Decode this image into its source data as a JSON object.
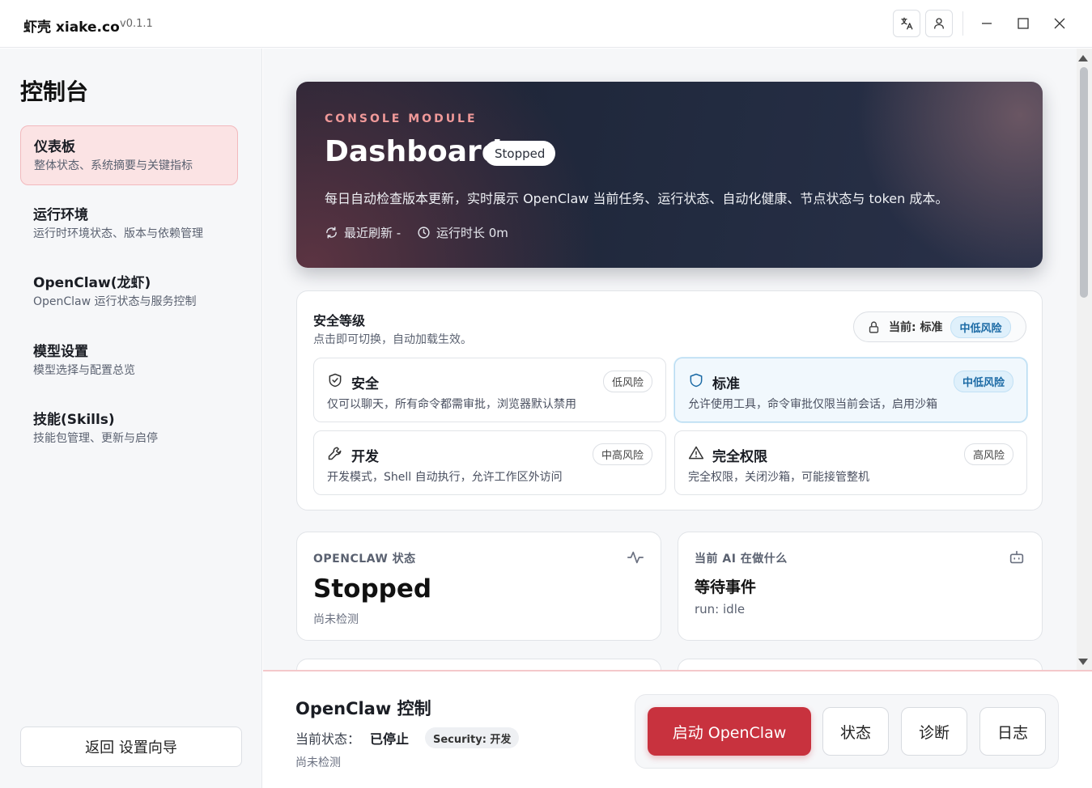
{
  "app": {
    "title": "虾壳 xiake.co",
    "version": "v0.1.1"
  },
  "titlebar": {
    "translate_icon": "translate-icon",
    "user_icon": "user-icon",
    "minimize_icon": "minimize-icon",
    "maximize_icon": "maximize-icon",
    "close_icon": "close-icon"
  },
  "sidebar": {
    "title": "控制台",
    "items": [
      {
        "label": "仪表板",
        "desc": "整体状态、系统摘要与关键指标",
        "active": true
      },
      {
        "label": "运行环境",
        "desc": "运行时环境状态、版本与依赖管理"
      },
      {
        "label": "OpenClaw(龙虾)",
        "desc": "OpenClaw 运行状态与服务控制"
      },
      {
        "label": "模型设置",
        "desc": "模型选择与配置总览"
      },
      {
        "label": "技能(Skills)",
        "desc": "技能包管理、更新与启停"
      }
    ],
    "back_label": "返回 设置向导"
  },
  "hero": {
    "kicker": "CONSOLE MODULE",
    "title": "Dashboard",
    "badge": "Stopped",
    "desc": "每日自动检查版本更新，实时展示 OpenClaw 当前任务、运行状态、自动化健康、节点状态与 token 成本。",
    "refresh": "最近刷新 -",
    "uptime": "运行时长 0m"
  },
  "security": {
    "title": "安全等级",
    "subtitle": "点击即可切换，自动加载生效。",
    "current_label": "当前: 标准",
    "current_risk": "中低风险",
    "options": [
      {
        "title": "安全",
        "risk": "低风险",
        "desc": "仅可以聊天，所有命令都需审批，浏览器默认禁用",
        "icon": "shield-check-icon"
      },
      {
        "title": "标准",
        "risk": "中低风险",
        "desc": "允许使用工具，命令审批仅限当前会话，启用沙箱",
        "icon": "shield-icon",
        "active": true
      },
      {
        "title": "开发",
        "risk": "中高风险",
        "desc": "开发模式，Shell 自动执行，允许工作区外访问",
        "icon": "wrench-icon"
      },
      {
        "title": "完全权限",
        "risk": "高风险",
        "desc": "完全权限，关闭沙箱，可能接管整机",
        "icon": "warning-icon"
      }
    ]
  },
  "status_cards": {
    "openclaw": {
      "label": "OPENCLAW 状态",
      "value": "Stopped",
      "sub": "尚未检测"
    },
    "ai": {
      "label": "当前 AI 在做什么",
      "value": "等待事件",
      "sub": "run: idle"
    }
  },
  "bottom": {
    "title": "OpenClaw 控制",
    "state_label": "当前状态：",
    "state_value": "已停止",
    "security_badge": "Security: 开发",
    "sub": "尚未检测",
    "start_label": "启动 OpenClaw",
    "status_label": "状态",
    "diagnose_label": "诊断",
    "log_label": "日志"
  },
  "colors": {
    "accent": "#c8323e",
    "hero_bg": "#1c2233",
    "active_nav": "#fbe3e4",
    "risk_blue": "#1b6aa5"
  }
}
